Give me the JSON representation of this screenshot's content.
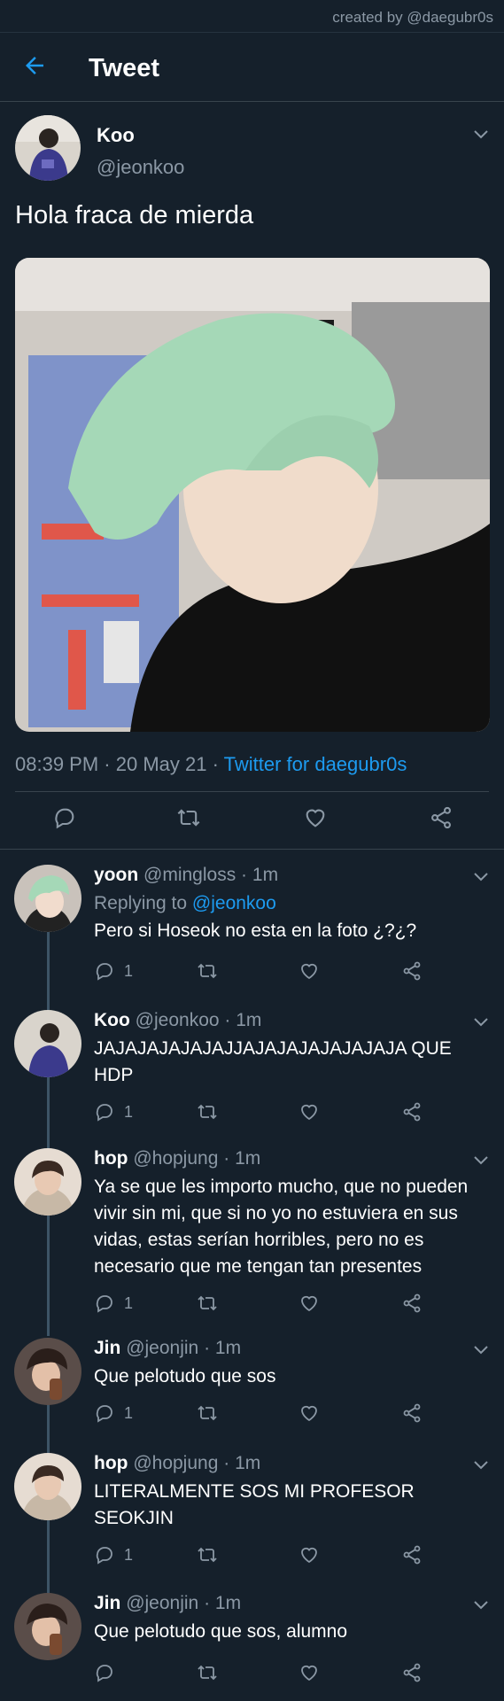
{
  "watermark": "created by @daegubr0s",
  "header": {
    "title": "Tweet",
    "back_icon": "arrow-left-icon"
  },
  "tweet": {
    "name": "Koo",
    "handle": "@jeonkoo",
    "text": "Hola fraca de mierda",
    "time": "08:39 PM",
    "date": "20 May 21",
    "source": "Twitter for daegubr0s",
    "sep": "·"
  },
  "replies": [
    {
      "name": "yoon",
      "handle": "@mingloss",
      "time": "1m",
      "replying_prefix": "Replying to",
      "replying_to": "@jeonkoo",
      "text": "Pero si Hoseok no esta en la foto ¿?¿?",
      "reply_count": "1"
    },
    {
      "name": "Koo",
      "handle": "@jeonkoo",
      "time": "1m",
      "text": "JAJAJAJAJAJAJJAJAJAJAJAJAJAJA QUE HDP",
      "reply_count": "1"
    },
    {
      "name": "hop",
      "handle": "@hopjung",
      "time": "1m",
      "text": "Ya se que les importo mucho, que no pueden vivir sin mi, que si no yo no estuviera en sus vidas, estas serían horribles, pero no es necesario que me tengan tan presentes",
      "reply_count": "1"
    },
    {
      "name": "Jin",
      "handle": "@jeonjin",
      "time": "1m",
      "text": "Que pelotudo que sos",
      "reply_count": "1"
    },
    {
      "name": "hop",
      "handle": "@hopjung",
      "time": "1m",
      "text": "LITERALMENTE SOS MI PROFESOR SEOKJIN",
      "reply_count": "1"
    },
    {
      "name": "Jin",
      "handle": "@jeonjin",
      "time": "1m",
      "text": "Que pelotudo que sos, alumno",
      "reply_count": ""
    }
  ],
  "colors": {
    "background": "#15202b",
    "accent": "#1d9bf0",
    "muted": "#8b98a5",
    "divider": "#38444d"
  }
}
